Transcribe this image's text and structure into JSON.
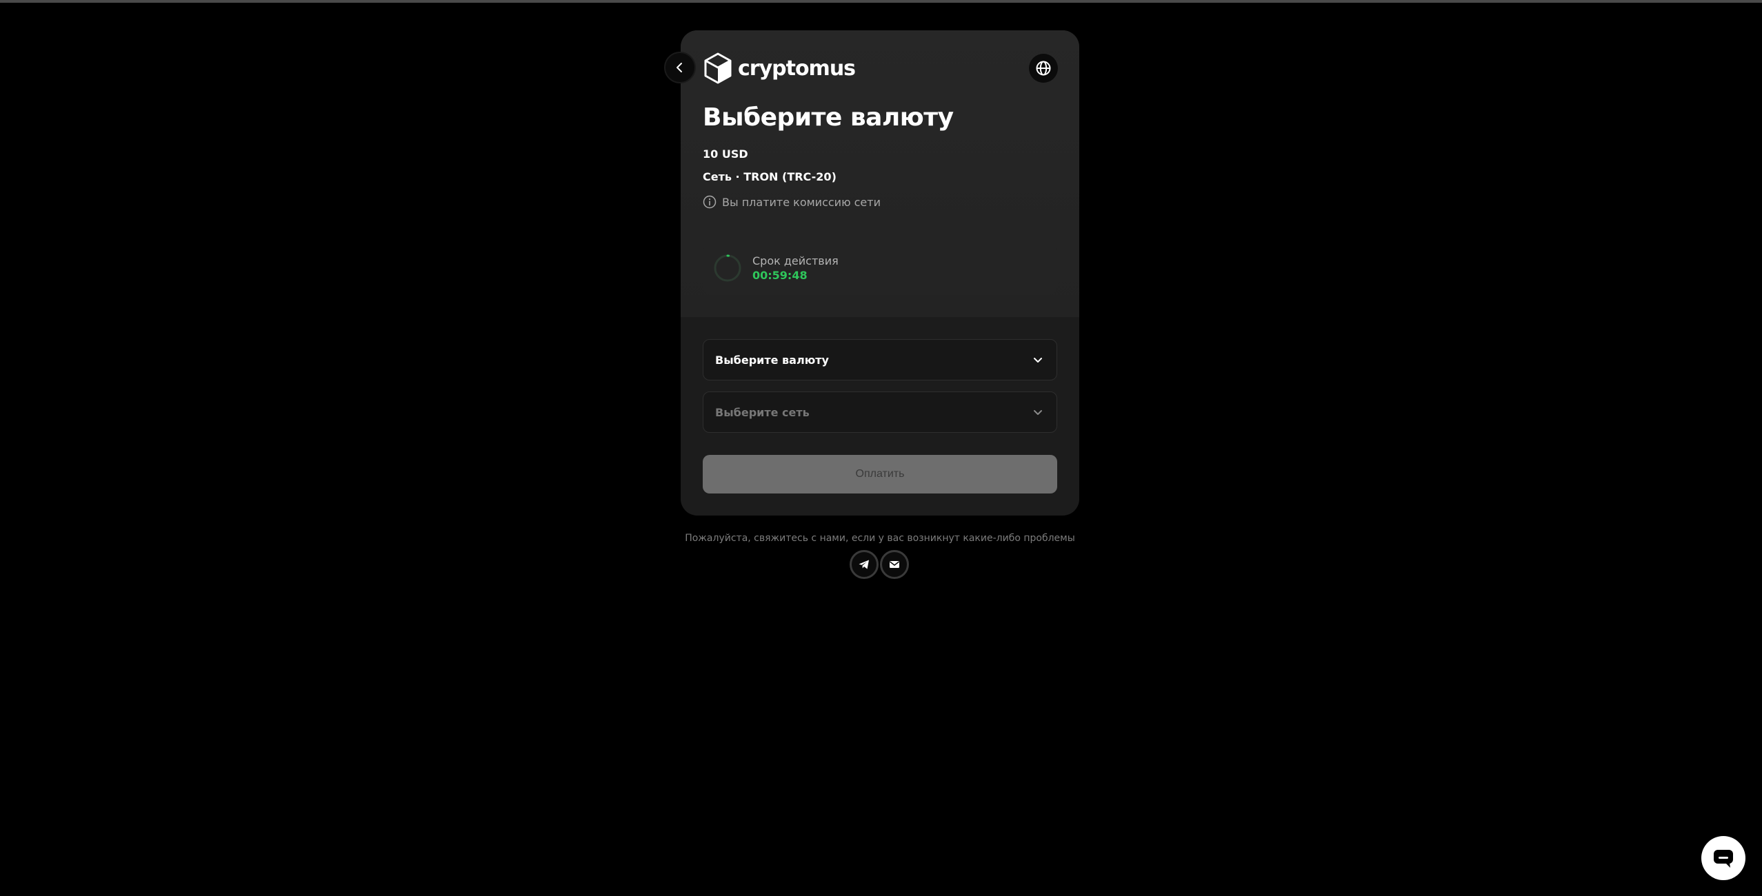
{
  "header": {
    "brand": "cryptomus",
    "back_icon": "chevron-left-icon",
    "language_icon": "globe-icon"
  },
  "payment": {
    "title": "Выберите валюту",
    "amount": "10 USD",
    "network_line": "Сеть · TRON (TRC-20)",
    "fee_note": "Вы платите комиссию сети"
  },
  "expiry": {
    "label": "Срок действия",
    "time": "00:59:48",
    "color": "#2fc65b"
  },
  "form": {
    "currency_select": "Выберите валюту",
    "network_select": "Выберите сеть",
    "pay_button": "Оплатить"
  },
  "footer": {
    "help_text": "Пожалуйста, свяжитесь с нами, если у вас возникнут какие-либо проблемы",
    "contacts": [
      "telegram-icon",
      "email-icon"
    ]
  },
  "chat": {
    "icon": "chat-bubble-icon"
  }
}
